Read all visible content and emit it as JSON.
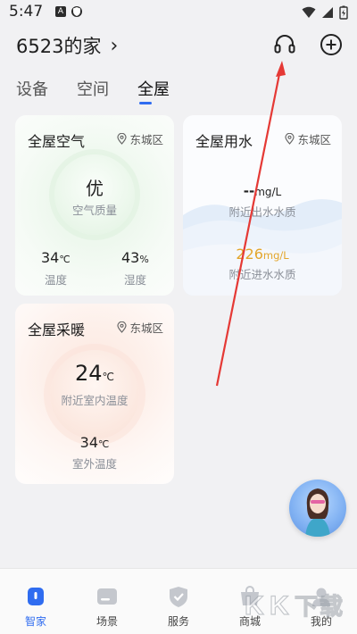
{
  "status_bar": {
    "time": "5:47",
    "app_icon_1": "A",
    "icons": [
      "wifi-icon",
      "signal-icon",
      "battery-icon"
    ]
  },
  "header": {
    "title": "6523的家",
    "chevron": "›",
    "icons": [
      "headset-icon",
      "add-icon"
    ]
  },
  "tabs": [
    {
      "label": "设备",
      "active": false
    },
    {
      "label": "空间",
      "active": false
    },
    {
      "label": "全屋",
      "active": true
    }
  ],
  "air_card": {
    "title": "全屋空气",
    "location": "东城区",
    "quality_value": "优",
    "quality_label": "空气质量",
    "temp_value": "34",
    "temp_unit": "℃",
    "temp_label": "温度",
    "humidity_value": "43",
    "humidity_unit": "%",
    "humidity_label": "湿度"
  },
  "water_card": {
    "title": "全屋用水",
    "location": "东城区",
    "out_value": "--",
    "out_unit": "mg/L",
    "out_label": "附近出水水质",
    "in_value": "226",
    "in_unit": "mg/L",
    "in_label": "附近进水水质"
  },
  "heating_card": {
    "title": "全屋采暖",
    "location": "东城区",
    "indoor_value": "24",
    "indoor_unit": "℃",
    "indoor_label": "附近室内温度",
    "outdoor_value": "34",
    "outdoor_unit": "℃",
    "outdoor_label": "室外温度"
  },
  "bottom_nav": [
    {
      "label": "智家",
      "icon": "home-icon",
      "active": true
    },
    {
      "label": "场景",
      "icon": "scene-icon",
      "active": false
    },
    {
      "label": "服务",
      "icon": "service-icon",
      "active": false
    },
    {
      "label": "商城",
      "icon": "shop-icon",
      "active": false
    },
    {
      "label": "我的",
      "icon": "profile-icon",
      "active": false
    }
  ],
  "watermark": "KK下载",
  "colors": {
    "accent": "#2f6cf0",
    "water_in": "#e3a62c",
    "annotation": "#e53935"
  }
}
